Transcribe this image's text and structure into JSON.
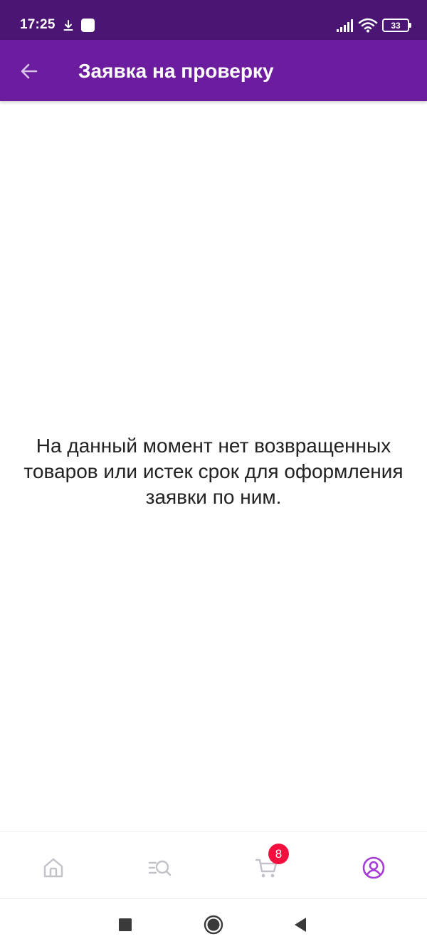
{
  "status_bar": {
    "time": "17:25",
    "battery": "33",
    "icons": [
      "download-icon",
      "notification-square-icon",
      "signal-icon",
      "wifi-icon",
      "battery-icon"
    ]
  },
  "app_bar": {
    "title": "Заявка на проверку",
    "back_icon": "arrow-left-icon",
    "background": "#6c1c9e",
    "status_background": "#4a1573"
  },
  "main": {
    "empty_message": "На данный момент нет возвращенных товаров или истек срок для оформления заявки по ним."
  },
  "bottom_nav": {
    "items": [
      {
        "icon": "home-icon",
        "active": false
      },
      {
        "icon": "catalog-search-icon",
        "active": false
      },
      {
        "icon": "cart-icon",
        "active": false,
        "badge": "8"
      },
      {
        "icon": "profile-icon",
        "active": true
      }
    ],
    "active_color": "#a63bd6",
    "inactive_color": "#c2c2c8",
    "badge_color": "#f3103f"
  },
  "system_nav": {
    "icons": [
      "recent-apps-icon",
      "home-circle-icon",
      "back-triangle-icon"
    ]
  }
}
